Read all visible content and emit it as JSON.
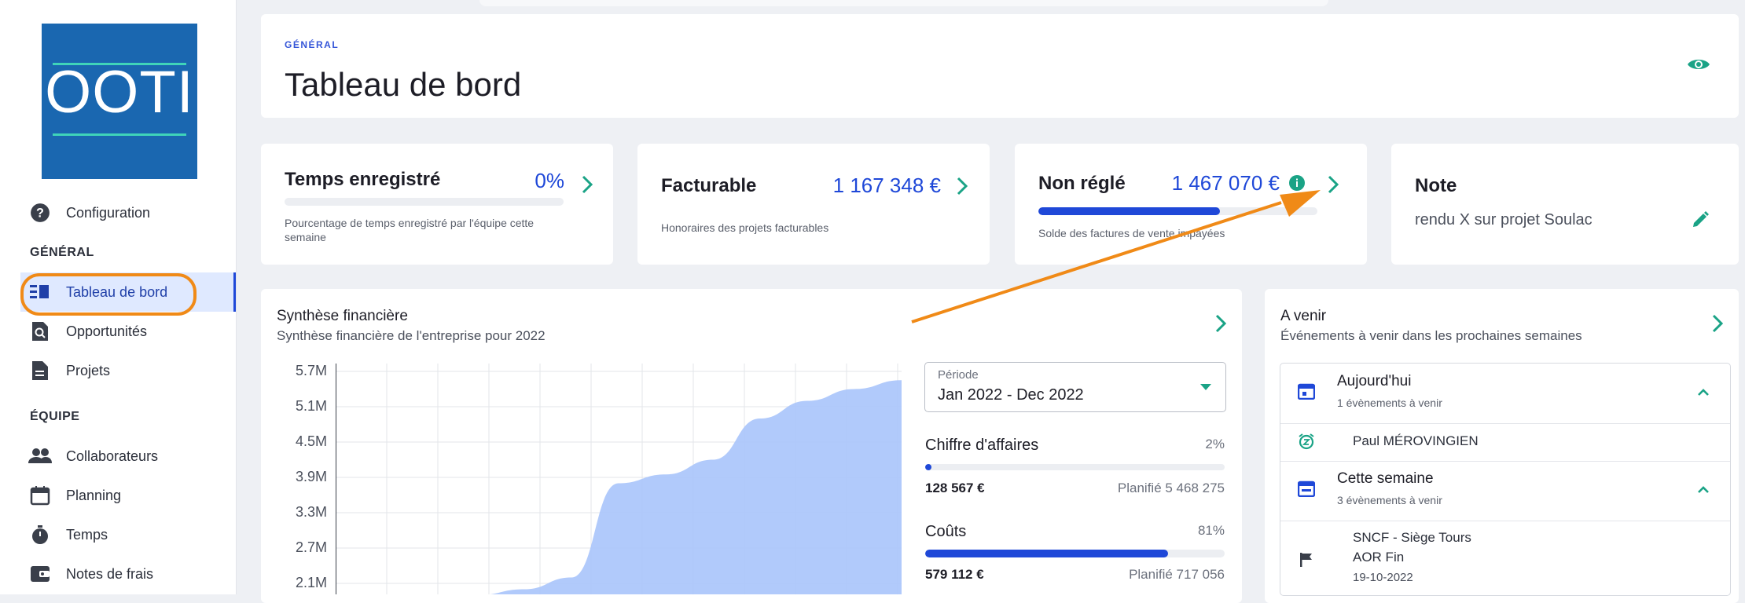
{
  "brand": {
    "logo_text": "OOTI"
  },
  "sidebar": {
    "config_label": "Configuration",
    "section_general": "GÉNÉRAL",
    "section_equipe": "ÉQUIPE",
    "items": [
      {
        "label": "Tableau de bord",
        "icon": "dashboard-icon"
      },
      {
        "label": "Opportunités",
        "icon": "search-doc-icon"
      },
      {
        "label": "Projets",
        "icon": "document-icon"
      },
      {
        "label": "Collaborateurs",
        "icon": "people-icon"
      },
      {
        "label": "Planning",
        "icon": "calendar-icon"
      },
      {
        "label": "Temps",
        "icon": "stopwatch-icon"
      },
      {
        "label": "Notes de frais",
        "icon": "wallet-icon"
      }
    ]
  },
  "header": {
    "overline": "GÉNÉRAL",
    "title": "Tableau de bord"
  },
  "kpis": {
    "temps": {
      "title": "Temps enregistré",
      "value": "0%",
      "desc": "Pourcentage de temps enregistré par l'équipe cette semaine",
      "progress": 0
    },
    "facturable": {
      "title": "Facturable",
      "value": "1 167 348 €",
      "desc": "Honoraires des projets facturables"
    },
    "non_regle": {
      "title": "Non réglé",
      "value": "1 467 070 €",
      "desc": "Solde des factures de vente impayées",
      "progress": 0.65
    },
    "note": {
      "title": "Note",
      "text": "rendu X sur projet Soulac"
    }
  },
  "synthese": {
    "title": "Synthèse financière",
    "subtitle": "Synthèse financière de l'entreprise pour 2022",
    "period_label": "Période",
    "period_value": "Jan 2022 - Dec 2022",
    "ca": {
      "name": "Chiffre d'affaires",
      "pct": "2%",
      "amount": "128 567 €",
      "plan": "Planifié 5 468 275",
      "progress": 0.02
    },
    "couts": {
      "name": "Coûts",
      "pct": "81%",
      "amount": "579 112 €",
      "plan": "Planifié 717 056",
      "progress": 0.81
    }
  },
  "chart_data": {
    "type": "area",
    "yticks": [
      "5.7M",
      "5.1M",
      "4.5M",
      "3.9M",
      "3.3M",
      "2.7M",
      "2.1M"
    ],
    "ylim": [
      2.1,
      5.7
    ],
    "x": [
      0,
      1,
      2,
      3,
      4,
      5,
      6,
      7,
      8,
      9,
      10,
      11,
      12
    ],
    "values": [
      1.6,
      1.7,
      1.8,
      1.9,
      2.0,
      2.2,
      3.8,
      3.95,
      4.2,
      4.9,
      5.2,
      5.4,
      5.55
    ],
    "color": "#a9c4fb"
  },
  "avenir": {
    "title": "A venir",
    "subtitle": "Événements à venir dans les prochaines semaines",
    "today": {
      "title": "Aujourd'hui",
      "sub": "1 évènements à venir"
    },
    "today_item": "Paul MÉROVINGIEN",
    "week": {
      "title": "Cette semaine",
      "sub": "3 évènements à venir"
    },
    "week_item": {
      "line1": "SNCF - Siège Tours",
      "line2": "AOR Fin",
      "line3": "19-10-2022"
    }
  },
  "colors": {
    "accent": "#1f48d8",
    "teal": "#1aa386",
    "annotation": "#f08a17"
  }
}
